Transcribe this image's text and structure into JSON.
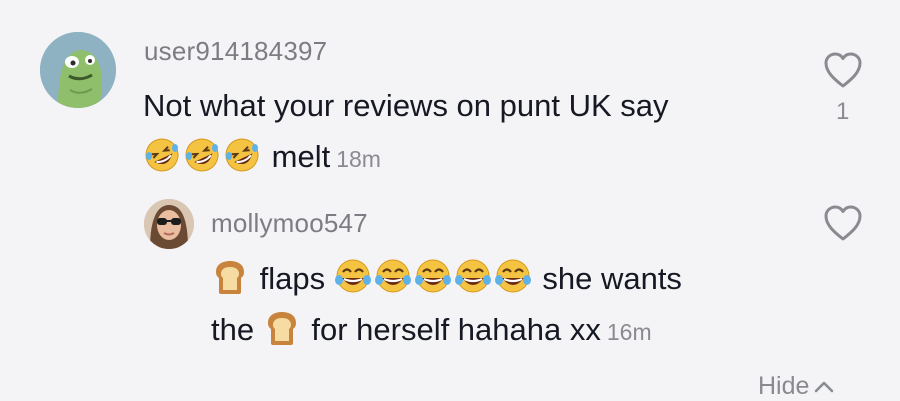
{
  "comment": {
    "username": "user914184397",
    "text_line1": "Not what your reviews on punt UK say",
    "text_line2": "melt",
    "time": "18m",
    "like_count": "1",
    "avatar_icon": "green-monster-avatar",
    "emojis": [
      "rofl",
      "rofl",
      "rofl"
    ]
  },
  "reply": {
    "username": "mollymoo547",
    "text_part1": "flaps",
    "text_part2": "she wants",
    "text_part3": "the",
    "text_part4": "for herself hahaha xx",
    "time": "16m",
    "emojis": [
      "bread",
      "joy",
      "joy",
      "joy",
      "joy",
      "joy",
      "bread"
    ]
  },
  "hide_label": "Hide",
  "icons": {
    "heart": "heart-outline-icon",
    "chevron": "chevron-up-icon"
  },
  "colors": {
    "background": "#f4f4f6",
    "text": "#161823",
    "secondary": "#8a8b91"
  }
}
